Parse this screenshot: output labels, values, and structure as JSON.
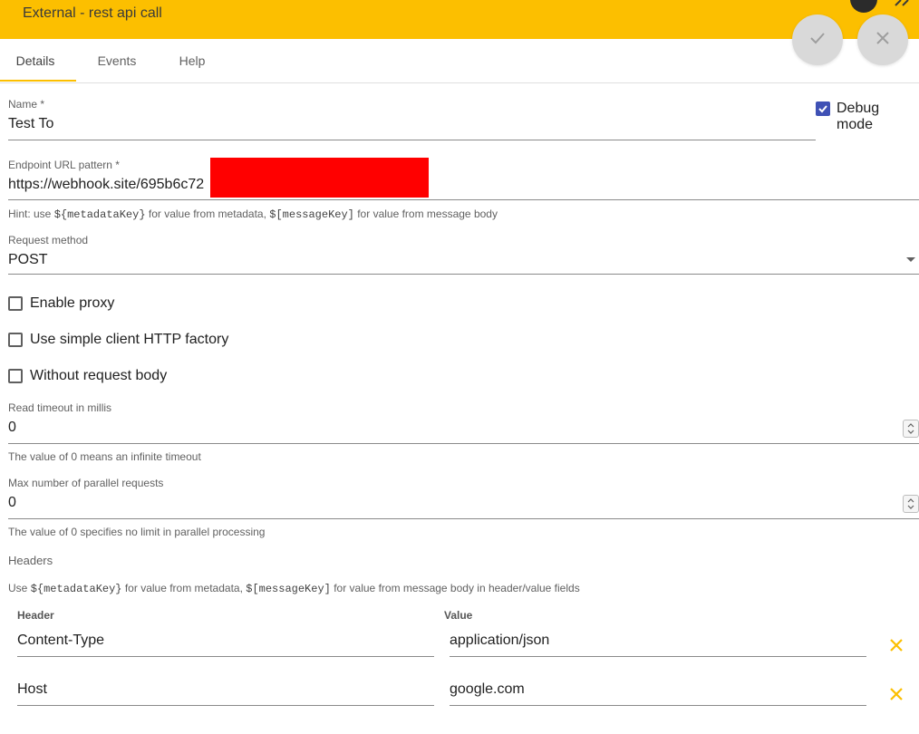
{
  "header": {
    "title": "External - rest api call"
  },
  "actions": {
    "save_icon": "check-icon",
    "close_icon": "close-icon"
  },
  "tabs": [
    {
      "label": "Details",
      "active": true
    },
    {
      "label": "Events",
      "active": false
    },
    {
      "label": "Help",
      "active": false
    }
  ],
  "form": {
    "name": {
      "label": "Name *",
      "value": "Test To"
    },
    "debug_mode": {
      "label": "Debug mode",
      "checked": true
    },
    "endpoint": {
      "label": "Endpoint URL pattern *",
      "value": "https://webhook.site/695b6c72"
    },
    "endpoint_hint": {
      "prefix": "Hint: use ",
      "code1": "${metadataKey}",
      "middle": " for value from metadata, ",
      "code2": "$[messageKey]",
      "suffix": " for value from message body"
    },
    "request_method": {
      "label": "Request method",
      "value": "POST"
    },
    "enable_proxy": {
      "label": "Enable proxy",
      "checked": false
    },
    "simple_client": {
      "label": "Use simple client HTTP factory",
      "checked": false
    },
    "without_body": {
      "label": "Without request body",
      "checked": false
    },
    "read_timeout": {
      "label": "Read timeout in millis",
      "value": "0",
      "hint": "The value of 0 means an infinite timeout"
    },
    "max_parallel": {
      "label": "Max number of parallel requests",
      "value": "0",
      "hint": "The value of 0 specifies no limit in parallel processing"
    },
    "headers": {
      "title": "Headers",
      "hint": {
        "prefix": "Use ",
        "code1": "${metadataKey}",
        "middle": " for value from metadata, ",
        "code2": "$[messageKey]",
        "suffix": " for value from message body in header/value fields"
      },
      "col_header": "Header",
      "col_value": "Value",
      "rows": [
        {
          "header": "Content-Type",
          "value": "application/json"
        },
        {
          "header": "Host",
          "value": "google.com"
        }
      ]
    }
  },
  "colors": {
    "accent": "#fcbf00",
    "checkbox": "#3f51b5",
    "remove_icon": "#fcbf00"
  }
}
